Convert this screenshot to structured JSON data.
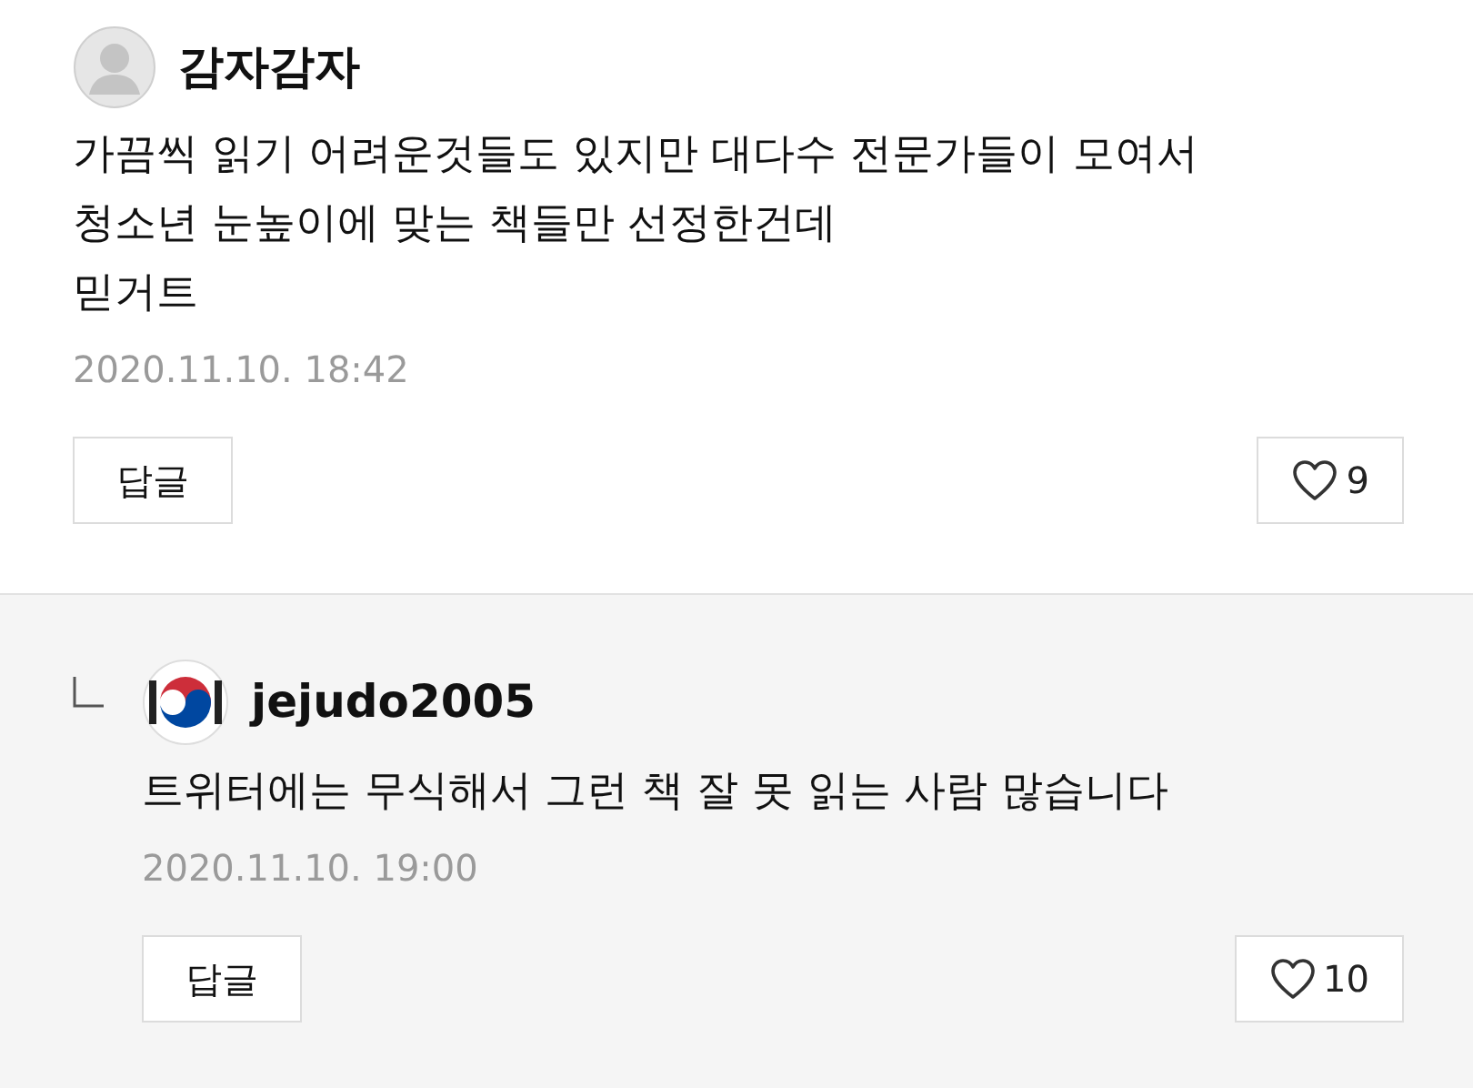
{
  "comments": [
    {
      "kind": "comment",
      "author": "감자감자",
      "lines": [
        "가끔씩 읽기 어려운것들도 있지만 대다수 전문가들이 모여서",
        "청소년 눈높이에 맞는 책들만 선정한건데",
        "믿거트"
      ],
      "date": "2020.11.10. 18:42",
      "reply_button": "답글",
      "likes": "9"
    },
    {
      "kind": "reply",
      "author": "jejudo2005",
      "lines": [
        "트위터에는 무식해서 그런 책 잘 못 읽는 사람 많습니다"
      ],
      "date": "2020.11.10. 19:00",
      "reply_button": "답글",
      "likes": "10"
    }
  ]
}
